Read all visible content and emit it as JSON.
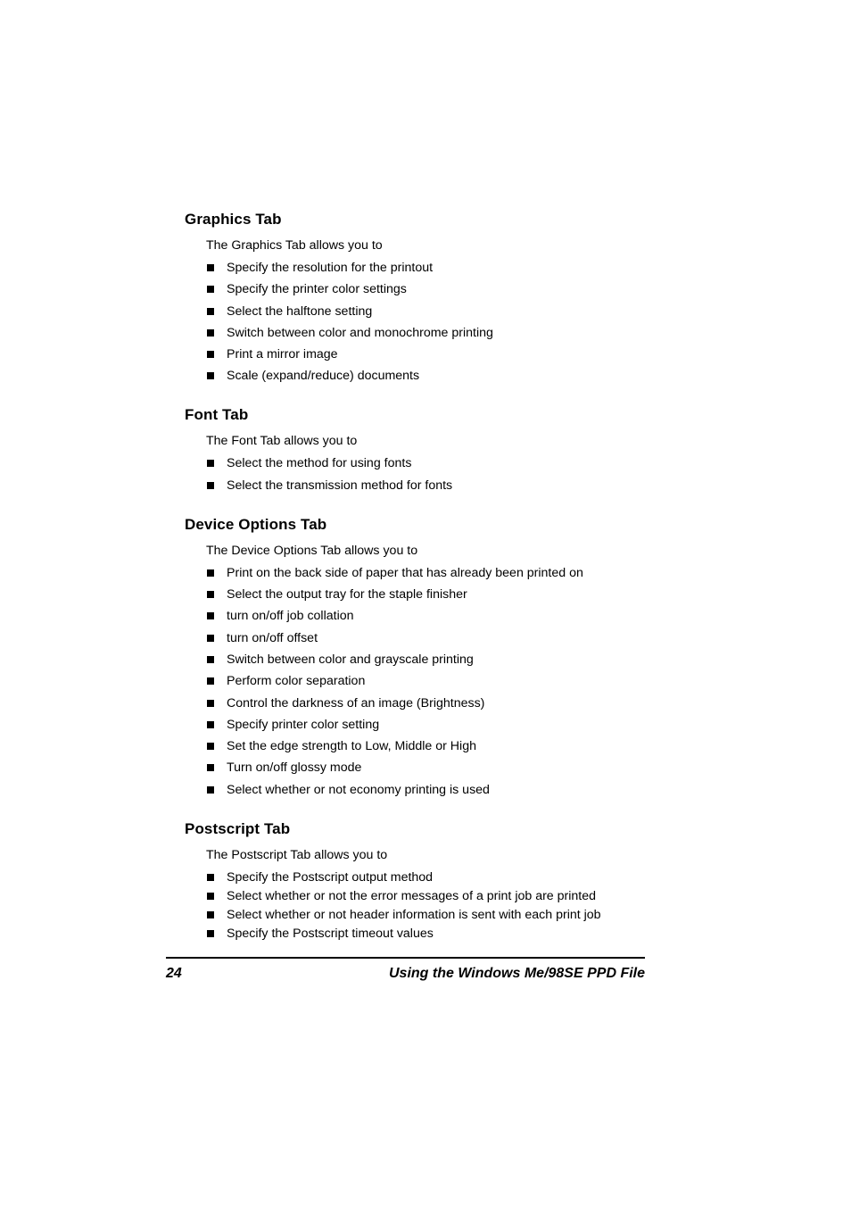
{
  "document": {
    "sections": [
      {
        "heading": "Graphics Tab",
        "intro": "The Graphics Tab allows you to",
        "items": [
          "Specify the resolution for the printout",
          "Specify the printer color settings",
          "Select the halftone setting",
          "Switch between color and monochrome printing",
          "Print a mirror image",
          "Scale (expand/reduce) documents"
        ]
      },
      {
        "heading": "Font Tab",
        "intro": "The Font Tab allows you to",
        "items": [
          "Select the method for using fonts",
          "Select the transmission method for fonts"
        ]
      },
      {
        "heading": "Device Options Tab",
        "intro": "The Device Options Tab allows you to",
        "items": [
          "Print on the back side of paper that has already been printed on",
          "Select the output tray for the staple finisher",
          "turn on/off job collation",
          "turn on/off offset",
          "Switch between color and grayscale printing",
          "Perform color separation",
          "Control the darkness of an image (Brightness)",
          "Specify printer color setting",
          "Set the edge strength to Low, Middle or High",
          "Turn on/off glossy mode",
          "Select whether or not economy printing is used"
        ]
      },
      {
        "heading": "Postscript Tab",
        "intro": "The Postscript Tab allows you to",
        "items": [
          "Specify the Postscript output method",
          "Select whether or not the error messages of a print job are printed",
          "Select whether or not header information is sent with each print job",
          "Specify the Postscript timeout values"
        ]
      }
    ]
  },
  "footer": {
    "page_number": "24",
    "title": "Using the Windows Me/98SE PPD File"
  }
}
